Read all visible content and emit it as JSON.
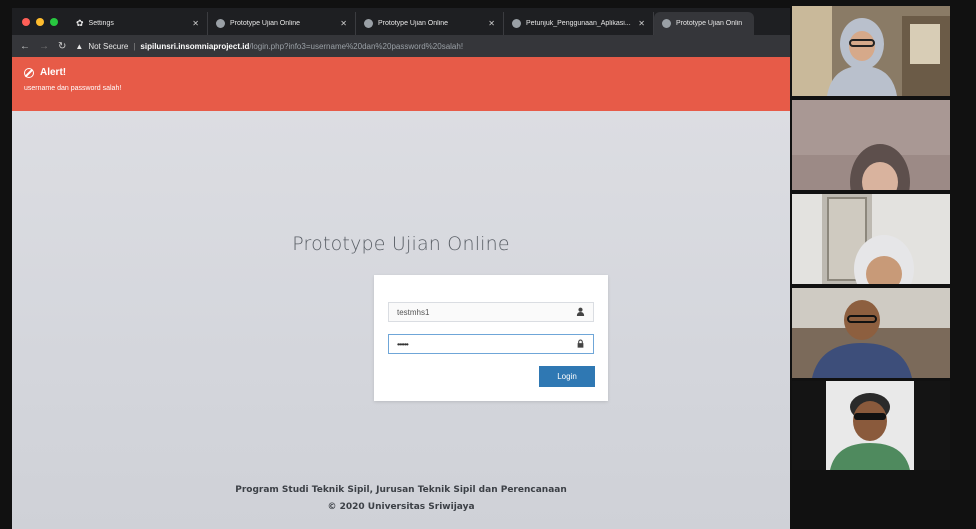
{
  "colors": {
    "alert_bg": "#e75b48",
    "button_bg": "#2f78b3",
    "tab_strip": "#1e1f22"
  },
  "browser": {
    "tabs": [
      {
        "title": "Settings",
        "icon": "gear-icon",
        "active": false
      },
      {
        "title": "Prototype Ujian Online",
        "icon": "globe-icon",
        "active": false
      },
      {
        "title": "Prototype Ujian Online",
        "icon": "globe-icon",
        "active": false
      },
      {
        "title": "Petunjuk_Penggunaan_Aplikasi...",
        "icon": "globe-icon",
        "active": false
      },
      {
        "title": "Prototype Ujian Onlin",
        "icon": "globe-icon",
        "active": true
      }
    ],
    "security_label": "Not Secure",
    "url_host": "sipilunsri.insomniaproject.id",
    "url_path": "/login.php?info3=username%20dan%20password%20salah!"
  },
  "alert": {
    "title": "Alert!",
    "message": "username dan password salah!"
  },
  "login": {
    "app_title": "Prototype Ujian Online",
    "username_value": "testmhs1",
    "password_value": "••••••",
    "button_label": "Login"
  },
  "footer": {
    "line1": "Program Studi Teknik Sipil, Jurusan Teknik Sipil dan Perencanaan",
    "line2": "© 2020 Universitas Sriwijaya"
  },
  "video_participants": [
    {
      "name": "participant-1"
    },
    {
      "name": "participant-2"
    },
    {
      "name": "participant-3"
    },
    {
      "name": "participant-4"
    },
    {
      "name": "participant-5"
    }
  ]
}
